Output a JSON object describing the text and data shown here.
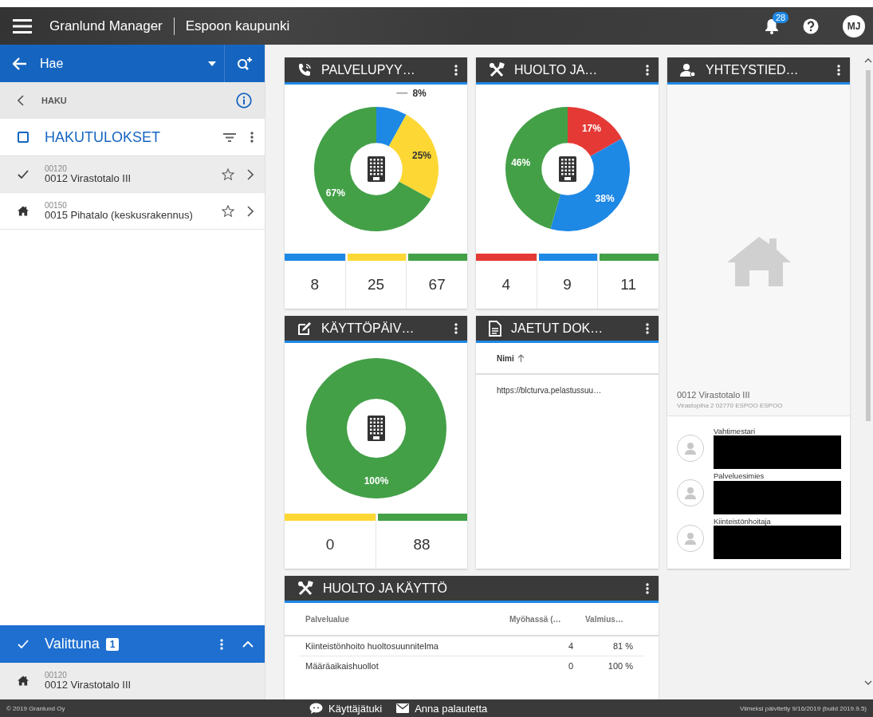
{
  "header": {
    "app_name": "Granlund Manager",
    "organization": "Espoon kaupunki",
    "notification_count": "28",
    "user_initials": "MJ"
  },
  "sidebar": {
    "search": {
      "value": "Hae"
    },
    "breadcrumb": "HAKU",
    "results_title": "HAKUTULOKSET",
    "results_checked": false,
    "items": [
      {
        "kind": "check",
        "code": "00120",
        "name": "0012 Virastotalo III",
        "selected": true,
        "starred": false
      },
      {
        "kind": "house",
        "code": "00150",
        "name": "0015 Pihatalo (keskusrakennus)",
        "selected": false,
        "starred": false
      }
    ],
    "selected_panel": {
      "title": "Valittuna",
      "count": "1",
      "expanded": true,
      "items": [
        {
          "kind": "house",
          "code": "00120",
          "name": "0012 Virastotalo III"
        }
      ]
    }
  },
  "cards": [
    {
      "kind": "donut",
      "title": "PALVELUPYY…",
      "chart_data": {
        "type": "donut",
        "values": [
          8,
          25,
          67
        ],
        "colors": [
          "#1e88e5",
          "#fdd835",
          "#43a047"
        ],
        "value_labels": [
          "8%",
          "25%",
          "67%"
        ]
      },
      "legend": [
        {
          "color": "#1e88e5",
          "count": "8"
        },
        {
          "color": "#fdd835",
          "count": "25"
        },
        {
          "color": "#43a047",
          "count": "67"
        }
      ]
    },
    {
      "kind": "donut",
      "title": "HUOLTO JA…",
      "chart_data": {
        "type": "donut",
        "values": [
          17,
          38,
          46
        ],
        "colors": [
          "#e53935",
          "#1e88e5",
          "#43a047"
        ],
        "value_labels": [
          "17%",
          "38%",
          "46%"
        ]
      },
      "legend": [
        {
          "color": "#e53935",
          "count": "4"
        },
        {
          "color": "#1e88e5",
          "count": "9"
        },
        {
          "color": "#43a047",
          "count": "11"
        }
      ]
    },
    {
      "kind": "contacts",
      "title": "YHTEYSTIED…",
      "building": "0012 Virastotalo III",
      "address": "Virastopiha 2 02770 ESPOO ESPOO",
      "contacts": [
        {
          "role": "Vahtimestari",
          "redacted": true
        },
        {
          "role": "Palveluesimies",
          "redacted": true
        },
        {
          "role": "Kiinteistönhoitaja",
          "redacted": true
        }
      ]
    },
    {
      "kind": "donut",
      "title": "KÄYTTÖPÄIV…",
      "chart_data": {
        "type": "donut",
        "values": [
          100
        ],
        "colors": [
          "#43a047"
        ],
        "value_labels": [
          "100%"
        ]
      },
      "legend": [
        {
          "color": "#fdd835",
          "count": "0"
        },
        {
          "color": "#43a047",
          "count": "88"
        }
      ]
    },
    {
      "kind": "documents",
      "title": "JAETUT DOK…",
      "column": "Nimi",
      "rows": [
        "https://blcturva.pelastussuu…"
      ]
    },
    {
      "kind": "table",
      "title": "HUOLTO JA KÄYTTÖ",
      "columns": [
        "Palvelualue",
        "Myöhassä (…",
        "Valmius…"
      ],
      "rows": [
        [
          "Kiinteistönhoito huoltosuunnitelma",
          "4",
          "81 %"
        ],
        [
          "Määräaikaishuollot",
          "0",
          "100 %"
        ]
      ]
    }
  ],
  "footer": {
    "copyright": "© 2019 Granlund Oy",
    "links": [
      {
        "label": "Käyttäjätuki"
      },
      {
        "label": "Anna palautetta"
      }
    ],
    "updated": "Viimeksi päivitetty 9/16/2019 (build 2019.9.5)"
  }
}
